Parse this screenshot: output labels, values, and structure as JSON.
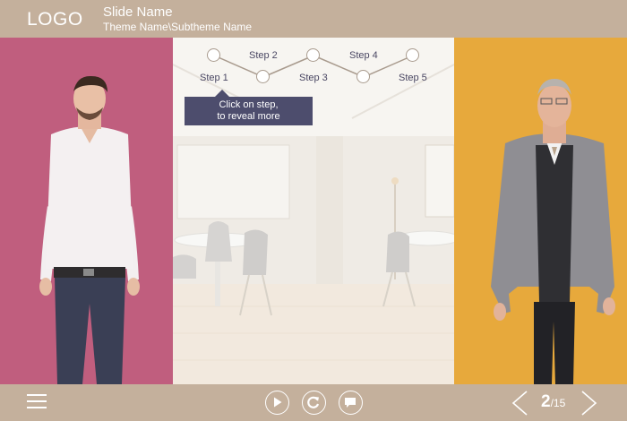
{
  "header": {
    "logo": "LOGO",
    "slide_name": "Slide Name",
    "theme_path": "Theme Name\\Subtheme Name"
  },
  "steps": [
    {
      "label": "Step 1",
      "position": "below"
    },
    {
      "label": "Step 2",
      "position": "above"
    },
    {
      "label": "Step 3",
      "position": "below"
    },
    {
      "label": "Step 4",
      "position": "above"
    },
    {
      "label": "Step 5",
      "position": "below"
    }
  ],
  "tooltip": {
    "line1": "Click on step,",
    "line2": "to reveal more"
  },
  "footer": {
    "page_current": "2",
    "page_total": "/15"
  },
  "colors": {
    "bar": "#c4b09c",
    "left_panel": "#c05e7e",
    "right_panel": "#e7a93c",
    "tooltip": "#4d4d6d"
  },
  "icons": [
    "menu-icon",
    "play-icon",
    "replay-icon",
    "chat-icon",
    "prev-arrow-icon",
    "next-arrow-icon"
  ]
}
